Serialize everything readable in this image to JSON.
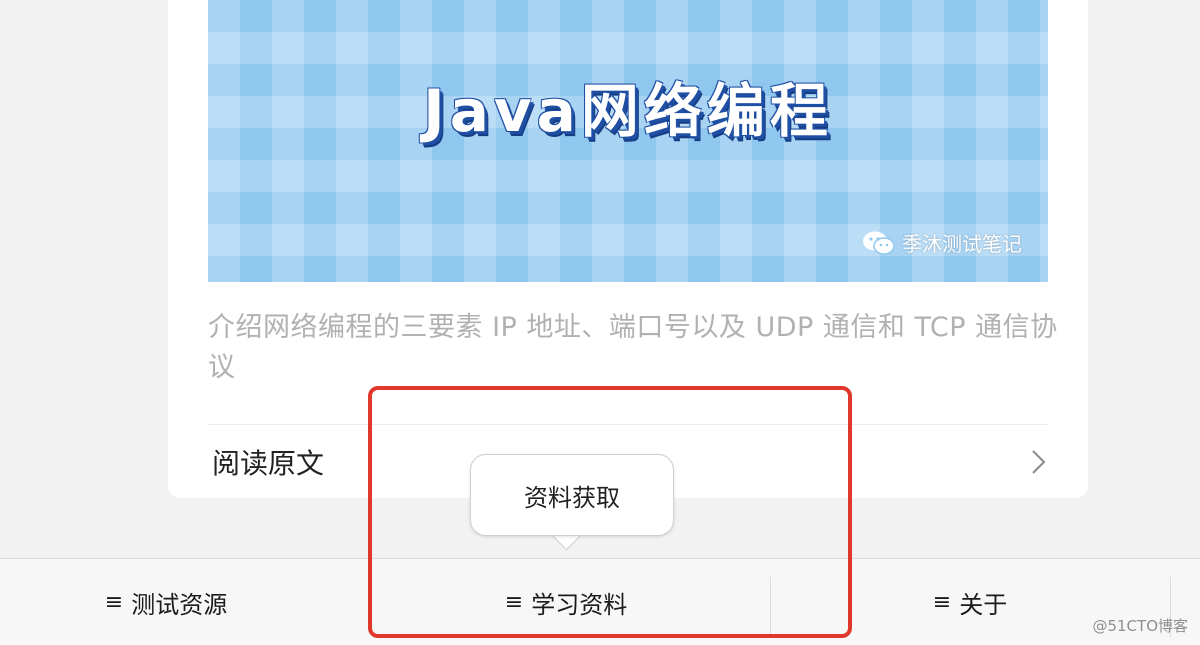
{
  "article": {
    "cover_title": "Java网络编程",
    "cover_watermark": "季沐测试笔记",
    "description": "介绍网络编程的三要素 IP 地址、端口号以及 UDP 通信和 TCP 通信协议",
    "read_original_label": "阅读原文"
  },
  "popup": {
    "label": "资料获取"
  },
  "menu": {
    "items": [
      {
        "icon": "≡",
        "label": "测试资源"
      },
      {
        "icon": "≡",
        "label": "学习资料"
      },
      {
        "icon": "≡",
        "label": "关于"
      }
    ]
  },
  "watermark": "@51CTO博客",
  "colors": {
    "highlight": "#e0392b",
    "cover_bg": "#8fc7ef",
    "description_text": "#b1b1b1"
  }
}
